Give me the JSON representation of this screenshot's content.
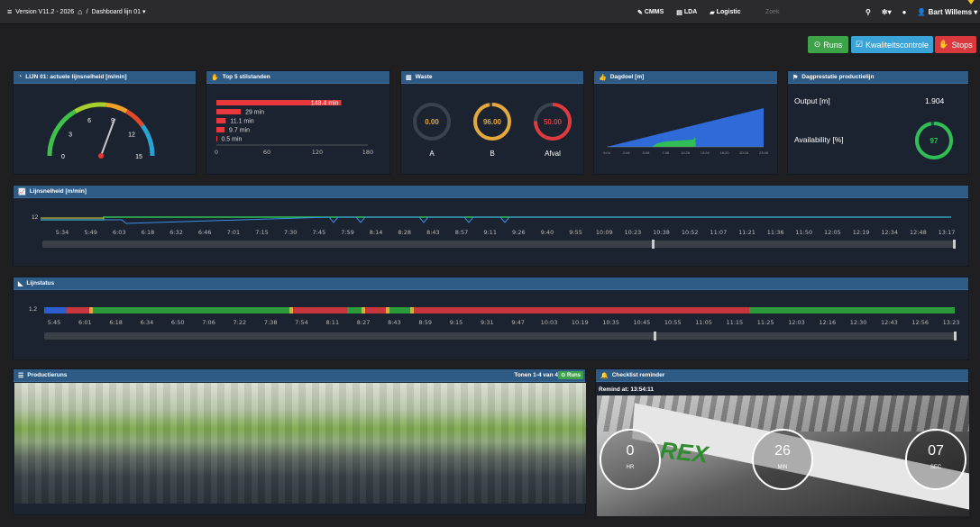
{
  "topbar": {
    "version": "Version V11.2 - 2026",
    "home_sep": "/",
    "breadcrumb": "Dashboard lijn 01",
    "cmms": "CMMS",
    "lda": "LDA",
    "logistic": "Logistic",
    "search_placeholder": "Zoek",
    "user": "Bart Willems"
  },
  "buttons": {
    "runs": "Runs",
    "kwaliteit": "Kwaliteitscontrole",
    "stops": "Stops"
  },
  "panels": {
    "speed": {
      "title": "LIJN 01: actuele lijnsnelheid [m/min]",
      "ticks": [
        "0",
        "3",
        "6",
        "9",
        "12",
        "15"
      ],
      "value": 9.2,
      "max": 15
    },
    "top5": {
      "title": "Top 5 stilstanden",
      "bars": [
        {
          "label": "148.4 min",
          "value": 148.4
        },
        {
          "label": "29 min",
          "value": 29
        },
        {
          "label": "11.1 min",
          "value": 11.1
        },
        {
          "label": "9.7 min",
          "value": 9.7
        },
        {
          "label": "0.5 min",
          "value": 0.5
        }
      ],
      "axis": [
        "0",
        "60",
        "120",
        "180"
      ]
    },
    "waste": {
      "title": "Waste",
      "rings": [
        {
          "value": "0.00",
          "label": "A",
          "color": "#e4a93a"
        },
        {
          "value": "96.00",
          "label": "B",
          "color": "#e4a93a"
        },
        {
          "value": "50.00",
          "label": "Afval",
          "color": "#e0393e"
        }
      ]
    },
    "dagdoel": {
      "title": "Dagdoel [m]",
      "ticks": [
        "0:04",
        "2:44",
        "5:08",
        "7:48",
        "10:28",
        "13:24",
        "16:20",
        "20:16",
        "23:48"
      ]
    },
    "dagprestatie": {
      "title": "Dagprestatie productielijn",
      "output_label": "Output [m]",
      "output_value": "1.904",
      "avail_label": "Availability [%]",
      "avail_value": "97"
    },
    "lijnsnelheid": {
      "title": "Lijnsnelheid [m/min]",
      "y": "12",
      "ticks": [
        "5:34",
        "5:49",
        "6:03",
        "6:18",
        "6:32",
        "6:46",
        "7:01",
        "7:15",
        "7:30",
        "7:45",
        "7:59",
        "8:14",
        "8:28",
        "8:43",
        "8:57",
        "9:11",
        "9:26",
        "9:40",
        "9:55",
        "10:09",
        "10:23",
        "10:38",
        "10:52",
        "11:07",
        "11:21",
        "11:36",
        "11:50",
        "12:05",
        "12:19",
        "12:34",
        "12:48",
        "13:17"
      ]
    },
    "lijnstatus": {
      "title": "Lijnstatus",
      "y": "1.2",
      "ticks": [
        "5:45",
        "6:01",
        "6:18",
        "6:34",
        "6:50",
        "7:06",
        "7:22",
        "7:38",
        "7:54",
        "8:11",
        "8:27",
        "8:43",
        "8:59",
        "9:15",
        "9:31",
        "9:47",
        "10:03",
        "10:19",
        "10:35",
        "10:45",
        "10:55",
        "11:05",
        "11:15",
        "11:25",
        "12:03",
        "12:16",
        "12:30",
        "12:43",
        "12:56",
        "13:23"
      ]
    },
    "productieruns": {
      "title": "Productieruns",
      "count": "Tonen 1-4 van 4",
      "runs_btn": "Runs"
    },
    "checklist": {
      "title": "Checklist reminder",
      "remind": "Remind at: 13:54:11",
      "hr": "0",
      "hr_label": "HR",
      "min": "26",
      "min_label": "MIN",
      "sec": "07",
      "sec_label": "SEC",
      "logo": "REX"
    }
  }
}
